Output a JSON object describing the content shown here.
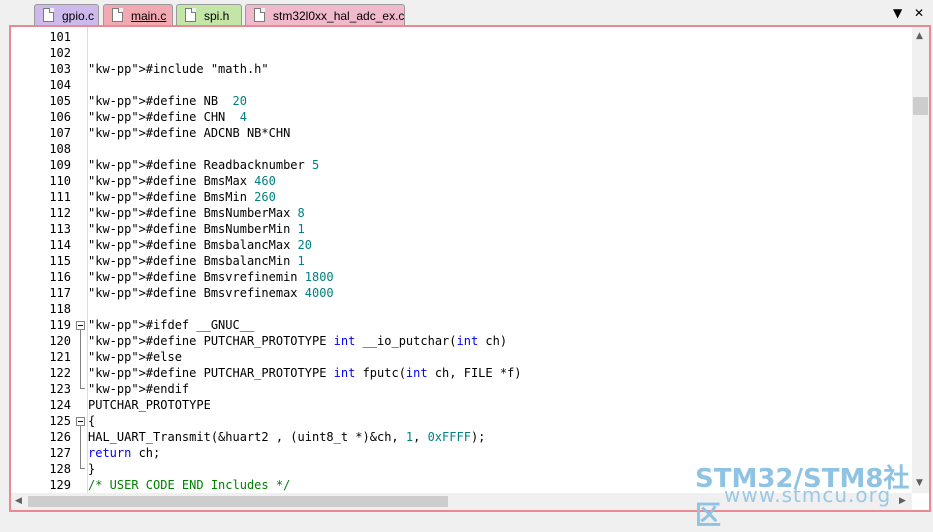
{
  "tabs": [
    {
      "label": "gpio.c",
      "color": "#cdb9ec",
      "active": false
    },
    {
      "label": "main.c",
      "color": "#f3a9b2",
      "active": true
    },
    {
      "label": "spi.h",
      "color": "#c4e5a8",
      "active": false
    },
    {
      "label": "stm32l0xx_hal_adc_ex.c",
      "color": "#f0b9cc",
      "active": false
    }
  ],
  "controls": {
    "dropdown": "▼",
    "close": "✕"
  },
  "lines": [
    {
      "n": "101",
      "code": ""
    },
    {
      "n": "102",
      "code": ""
    },
    {
      "n": "103",
      "code": "#include \"math.h\""
    },
    {
      "n": "104",
      "code": ""
    },
    {
      "n": "105",
      "code": "#define NB  20"
    },
    {
      "n": "106",
      "code": "#define CHN  4"
    },
    {
      "n": "107",
      "code": "#define ADCNB NB*CHN"
    },
    {
      "n": "108",
      "code": ""
    },
    {
      "n": "109",
      "code": "#define Readbacknumber 5"
    },
    {
      "n": "110",
      "code": "#define BmsMax 460"
    },
    {
      "n": "111",
      "code": "#define BmsMin 260"
    },
    {
      "n": "112",
      "code": "#define BmsNumberMax 8"
    },
    {
      "n": "113",
      "code": "#define BmsNumberMin 1"
    },
    {
      "n": "114",
      "code": "#define BmsbalancMax 20"
    },
    {
      "n": "115",
      "code": "#define BmsbalancMin 1"
    },
    {
      "n": "116",
      "code": "#define Bmsvrefinemin 1800"
    },
    {
      "n": "117",
      "code": "#define Bmsvrefinemax 4000"
    },
    {
      "n": "118",
      "code": ""
    },
    {
      "n": "119",
      "code": "#ifdef __GNUC__"
    },
    {
      "n": "120",
      "code": "#define PUTCHAR_PROTOTYPE int __io_putchar(int ch)"
    },
    {
      "n": "121",
      "code": "#else"
    },
    {
      "n": "122",
      "code": "#define PUTCHAR_PROTOTYPE int fputc(int ch, FILE *f)"
    },
    {
      "n": "123",
      "code": "#endif"
    },
    {
      "n": "124",
      "code": "PUTCHAR_PROTOTYPE"
    },
    {
      "n": "125",
      "code": "{"
    },
    {
      "n": "126",
      "code": "HAL_UART_Transmit(&huart2 , (uint8_t *)&ch, 1, 0xFFFF);"
    },
    {
      "n": "127",
      "code": "return ch;"
    },
    {
      "n": "128",
      "code": "}"
    },
    {
      "n": "129",
      "code": "/* USER CODE END Includes */"
    }
  ],
  "watermark": {
    "line1": "STM32/STM8社区",
    "line2": "www.stmcu.org"
  }
}
